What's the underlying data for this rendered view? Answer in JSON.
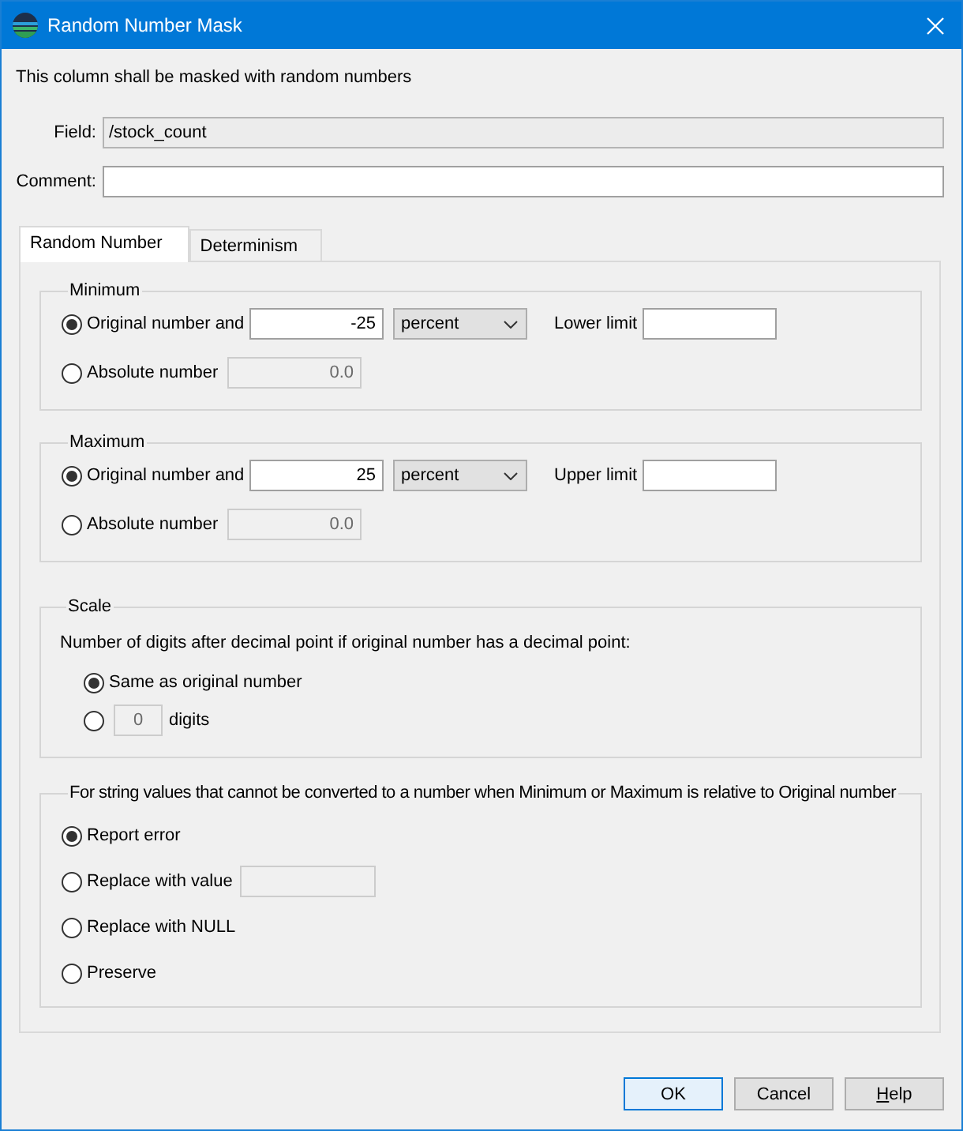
{
  "window": {
    "title": "Random Number Mask"
  },
  "description": "This column shall be masked with random numbers",
  "fields": [
    {
      "label": "Field:",
      "value": "/stock_count",
      "editable": false
    },
    {
      "label": "Comment:",
      "editable": true
    }
  ],
  "tabs": [
    {
      "label": "Random Number",
      "selected": true
    },
    {
      "label": "Determinism",
      "selected": false
    }
  ],
  "minimum": {
    "legend": "Minimum",
    "options": [
      {
        "kind": "relative",
        "label": "Original number and",
        "selected": true,
        "value": "-25",
        "unit": "percent",
        "limit_label": "Lower limit"
      },
      {
        "kind": "absolute",
        "label": "Absolute number",
        "selected": false,
        "value": "0.0",
        "disabled": true
      }
    ]
  },
  "maximum": {
    "legend": "Maximum",
    "options": [
      {
        "kind": "relative",
        "label": "Original number and",
        "selected": true,
        "value": "25",
        "unit": "percent",
        "limit_label": "Upper limit"
      },
      {
        "kind": "absolute",
        "label": "Absolute number",
        "selected": false,
        "value": "0.0",
        "disabled": true
      }
    ]
  },
  "scale": {
    "legend": "Scale",
    "prompt": "Number of digits after decimal point if original number has a decimal point:",
    "options": [
      {
        "kind": "plain",
        "label": "Same as original number",
        "selected": true
      },
      {
        "kind": "digits",
        "value": "0",
        "label": "digits",
        "selected": false,
        "disabled": true
      }
    ]
  },
  "conversion": {
    "legend": "For string values that cannot be converted to a number when Minimum or Maximum is relative to Original number",
    "options": [
      {
        "kind": "plain",
        "label": "Report error",
        "selected": true
      },
      {
        "kind": "value",
        "label": "Replace with value",
        "selected": false,
        "disabled": true
      },
      {
        "kind": "plain",
        "label": "Replace with NULL",
        "selected": false
      },
      {
        "kind": "plain",
        "label": "Preserve",
        "selected": false
      }
    ]
  },
  "buttons": [
    {
      "label": "OK",
      "default": true,
      "mnemonic": false
    },
    {
      "label": "Cancel",
      "default": false,
      "mnemonic": false
    },
    {
      "label": "Help",
      "default": false,
      "mnemonic": true
    }
  ]
}
